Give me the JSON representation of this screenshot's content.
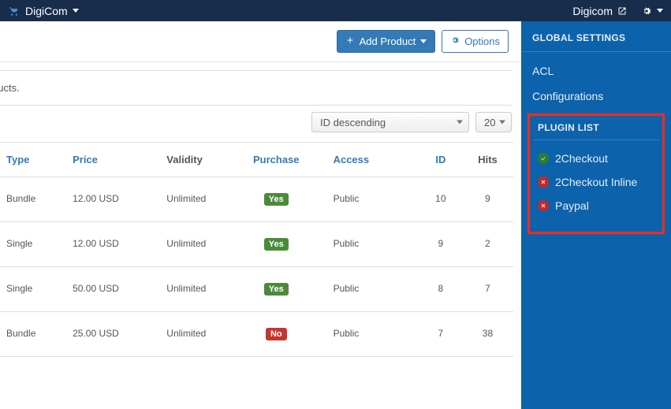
{
  "navbar": {
    "brand": "DigiCom",
    "right_link": "Digicom"
  },
  "toolbar": {
    "add_product": "Add Product",
    "options": "Options"
  },
  "content": {
    "blurb": "ducts."
  },
  "filters": {
    "sort": "ID descending",
    "pagesize": "20"
  },
  "table": {
    "headers": {
      "type": "Type",
      "price": "Price",
      "validity": "Validity",
      "purchase": "Purchase",
      "access": "Access",
      "id": "ID",
      "hits": "Hits"
    },
    "rows": [
      {
        "type": "Bundle",
        "price": "12.00 USD",
        "validity": "Unlimited",
        "purchase": "Yes",
        "access": "Public",
        "id": "10",
        "hits": "9"
      },
      {
        "type": "Single",
        "price": "12.00 USD",
        "validity": "Unlimited",
        "purchase": "Yes",
        "access": "Public",
        "id": "9",
        "hits": "2"
      },
      {
        "type": "Single",
        "price": "50.00 USD",
        "validity": "Unlimited",
        "purchase": "Yes",
        "access": "Public",
        "id": "8",
        "hits": "7"
      },
      {
        "type": "Bundle",
        "price": "25.00 USD",
        "validity": "Unlimited",
        "purchase": "No",
        "access": "Public",
        "id": "7",
        "hits": "38"
      }
    ]
  },
  "sidebar": {
    "global_heading": "GLOBAL SETTINGS",
    "acl": "ACL",
    "configurations": "Configurations",
    "plugin_heading": "PLUGIN LIST",
    "plugins": [
      {
        "name": "2Checkout",
        "enabled": true
      },
      {
        "name": "2Checkout Inline",
        "enabled": false
      },
      {
        "name": "Paypal",
        "enabled": false
      }
    ]
  }
}
